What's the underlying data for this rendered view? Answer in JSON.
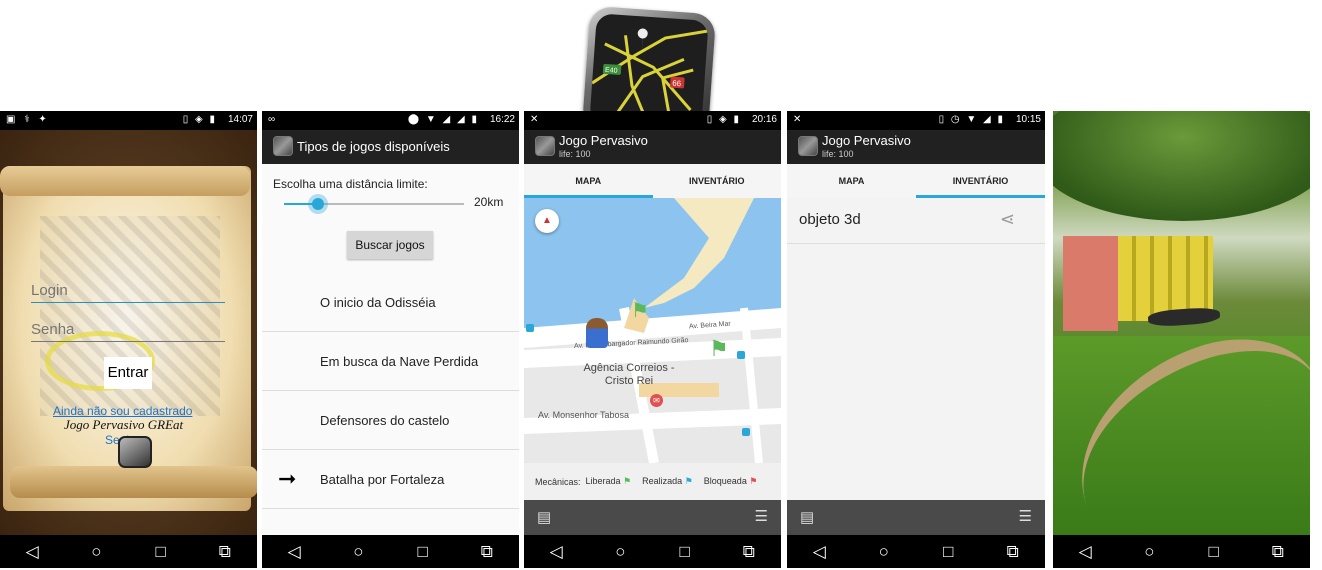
{
  "p1": {
    "login_placeholder": "Login",
    "password_placeholder": "Senha",
    "enter_label": "Entrar",
    "register_link": "Ainda não sou cadastrado",
    "brand_title": "Jogo Pervasivo GREat",
    "brand_sub": "Senhas",
    "time": "14:07"
  },
  "p2": {
    "title": "Tipos de jogos disponíveis",
    "distance_label": "Escolha uma distância limite:",
    "distance_value": "20km",
    "distance_fraction": 0.19,
    "search_button": "Buscar jogos",
    "games": [
      "O inicio da Odisséia",
      "Em busca da Nave Perdida",
      "Defensores do castelo",
      "Batalha por Fortaleza"
    ],
    "selected_index": 3,
    "time": "16:22"
  },
  "p3": {
    "title": "Jogo Pervasivo",
    "subtitle": "life: 100",
    "tabs": [
      "MAPA",
      "INVENTÁRIO"
    ],
    "active_tab": 0,
    "map_labels": {
      "street1": "Av. Beira Mar",
      "street2": "Av. Desembargador Raimundo Girão",
      "place": "Agência Correios - Cristo Rei",
      "street3": "Av. Monsenhor Tabosa"
    },
    "legend_prefix": "Mecânicas:",
    "legend_items": [
      {
        "label": "Liberada",
        "color": "#5cb85c"
      },
      {
        "label": "Realizada",
        "color": "#29a7d8"
      },
      {
        "label": "Bloqueada",
        "color": "#e05050"
      }
    ],
    "time": "20:16"
  },
  "p4": {
    "title": "Jogo Pervasivo",
    "subtitle": "life: 100",
    "tabs": [
      "MAPA",
      "INVENTÁRIO"
    ],
    "active_tab": 1,
    "item": "objeto 3d",
    "time": "10:15"
  },
  "logo": {
    "road_tag_1": "E40",
    "road_tag_2": "66"
  },
  "colors": {
    "accent": "#29a7d8",
    "bar": "#212121"
  }
}
